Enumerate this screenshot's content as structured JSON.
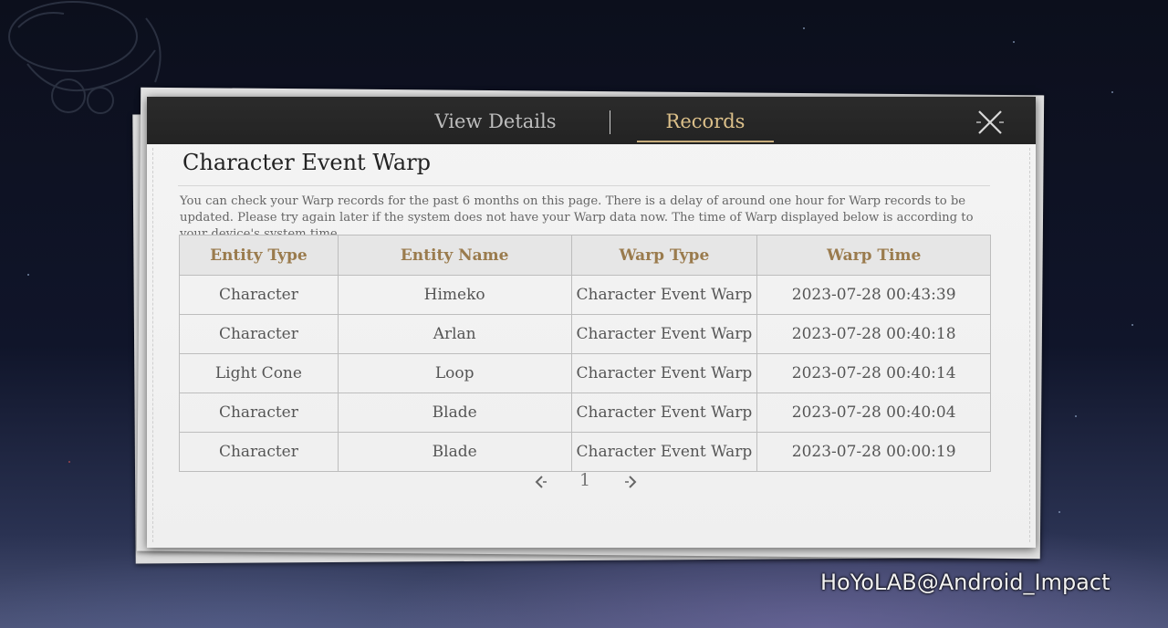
{
  "tabs": {
    "view_details": "View Details",
    "records": "Records"
  },
  "close_icon": "close-icon",
  "title": "Character Event Warp",
  "notice": "You can check your Warp records for the past 6 months on this page. There is a delay of around one hour for Warp records to be updated. Please try again later if the system does not have your Warp data now. The time of Warp displayed below is according to your device's system time.",
  "table": {
    "headers": [
      "Entity Type",
      "Entity Name",
      "Warp Type",
      "Warp Time"
    ],
    "rows": [
      {
        "type": "Character",
        "name": "Himeko",
        "warp": "Character Event Warp",
        "time": "2023-07-28 00:43:39"
      },
      {
        "type": "Character",
        "name": "Arlan",
        "warp": "Character Event Warp",
        "time": "2023-07-28 00:40:18"
      },
      {
        "type": "Light Cone",
        "name": "Loop",
        "warp": "Character Event Warp",
        "time": "2023-07-28 00:40:14"
      },
      {
        "type": "Character",
        "name": "Blade",
        "warp": "Character Event Warp",
        "time": "2023-07-28 00:40:04"
      },
      {
        "type": "Character",
        "name": "Blade",
        "warp": "Character Event Warp",
        "time": "2023-07-28 00:00:19"
      }
    ]
  },
  "pagination": {
    "current_page": "1",
    "prev_icon": "chevron-left-icon",
    "next_icon": "chevron-right-icon"
  },
  "colors": {
    "gold": "#d1a45c",
    "purple": "#a04fd6",
    "tab_active": "#dcc08a",
    "header_text": "#9a7b4d"
  },
  "watermark": "HoYoLAB@Android_Impact"
}
